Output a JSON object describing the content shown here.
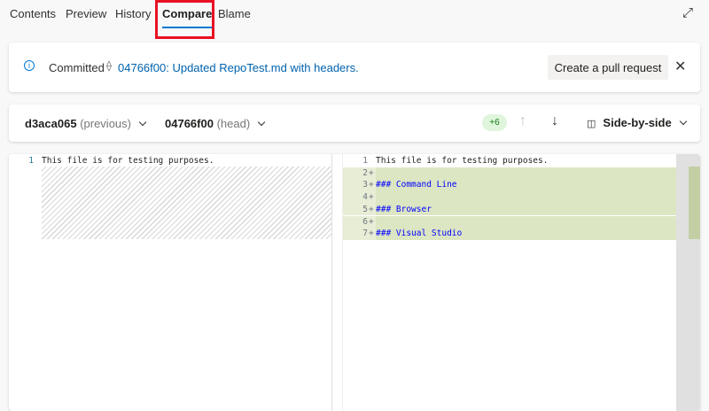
{
  "tabs": [
    {
      "label": "Contents"
    },
    {
      "label": "Preview"
    },
    {
      "label": "History"
    },
    {
      "label": "Compare"
    },
    {
      "label": "Blame"
    }
  ],
  "info": {
    "label": "Committed",
    "commit_link": "04766f00: Updated RepoTest.md with headers.",
    "pr_button": "Create a pull request"
  },
  "compare": {
    "base": "d3aca065",
    "base_tag": "(previous)",
    "target": "04766f00",
    "target_tag": "(head)",
    "changes": "+6",
    "mode": "Side-by-side"
  },
  "left_lines": [
    {
      "n": "1",
      "text": "This file is for testing purposes."
    }
  ],
  "right_lines": [
    {
      "n": "1",
      "mark": "",
      "text": "This file is for testing purposes.",
      "added": false
    },
    {
      "n": "2",
      "mark": "+",
      "text": "",
      "added": true
    },
    {
      "n": "3",
      "mark": "+",
      "text": "### Command Line",
      "added": true
    },
    {
      "n": "4",
      "mark": "+",
      "text": "",
      "added": true
    },
    {
      "n": "5",
      "mark": "+",
      "text": "### Browser",
      "added": true
    },
    {
      "n": "6",
      "mark": "+",
      "text": "",
      "added": true
    },
    {
      "n": "7",
      "mark": "+",
      "text": "### Visual Studio",
      "added": true
    }
  ]
}
